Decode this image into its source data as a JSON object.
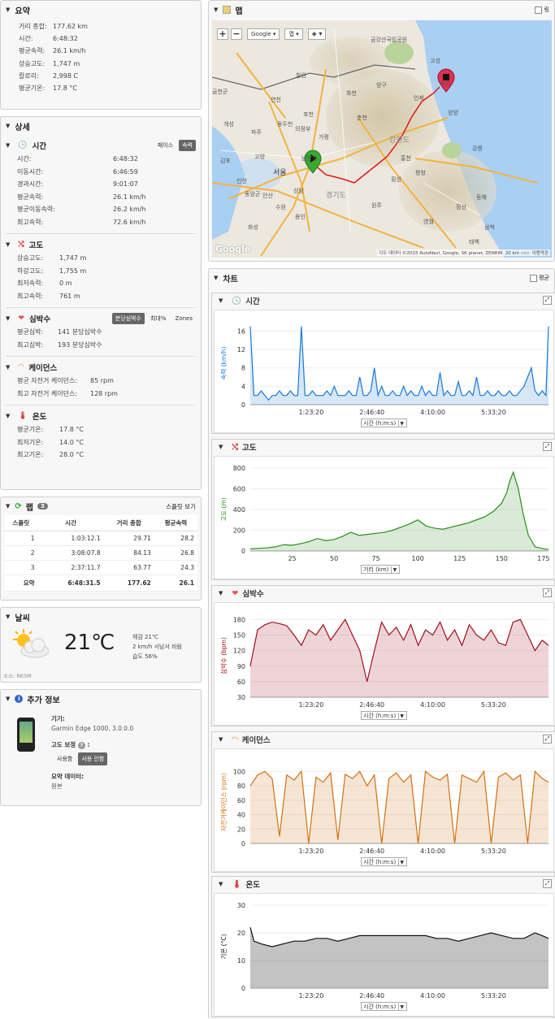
{
  "summary": {
    "title": "요약",
    "rows": [
      {
        "k": "거리 총합:",
        "v": "177.62 km"
      },
      {
        "k": "시간:",
        "v": "6:48:32"
      },
      {
        "k": "평균속력:",
        "v": "26.1 km/h"
      },
      {
        "k": "상승고도:",
        "v": "1,747 m"
      },
      {
        "k": "칼로리:",
        "v": "2,998 C"
      },
      {
        "k": "평균기온:",
        "v": "17.8 °C"
      }
    ]
  },
  "detail": {
    "title": "상세",
    "time": {
      "title": "시간",
      "pace": "페이스",
      "speed": "속력",
      "rows": [
        {
          "k": "시간:",
          "v": "6:48:32"
        },
        {
          "k": "이동시간:",
          "v": "6:46:59"
        },
        {
          "k": "경과시간:",
          "v": "9:01:07"
        },
        {
          "k": "평균속력:",
          "v": "26.1 km/h"
        },
        {
          "k": "평균이동속력:",
          "v": "26.2 km/h"
        },
        {
          "k": "최고속력:",
          "v": "72.6 km/h"
        }
      ]
    },
    "elev": {
      "title": "고도",
      "rows": [
        {
          "k": "상승고도:",
          "v": "1,747 m"
        },
        {
          "k": "하강고도:",
          "v": "1,755 m"
        },
        {
          "k": "최저속력:",
          "v": "0 m"
        },
        {
          "k": "최고속력:",
          "v": "761 m"
        }
      ]
    },
    "hr": {
      "title": "심박수",
      "opt1": "분당심박수",
      "opt2": "최대%",
      "opt3": "Zones",
      "rows": [
        {
          "k": "평균심박:",
          "v": "141 분당심박수"
        },
        {
          "k": "최고심박:",
          "v": "193 분당심박수"
        }
      ]
    },
    "cad": {
      "title": "케이던스",
      "rows": [
        {
          "k": "평균 자전거 케이던스:",
          "v": "85 rpm"
        },
        {
          "k": "최고 자전거 케이던스:",
          "v": "128 rpm"
        }
      ]
    },
    "temp": {
      "title": "온도",
      "rows": [
        {
          "k": "평균기온:",
          "v": "17.8 °C"
        },
        {
          "k": "최저기온:",
          "v": "14.0 °C"
        },
        {
          "k": "최고기온:",
          "v": "28.0 °C"
        }
      ]
    }
  },
  "laps": {
    "title": "랩",
    "count": "3",
    "split_view": "스플릿 보기",
    "headers": [
      "스플릿",
      "시간",
      "거리 총합",
      "평균속력"
    ],
    "rows": [
      [
        "1",
        "1:03:12.1",
        "29.71",
        "28.2"
      ],
      [
        "2",
        "3:08:07.8",
        "84.13",
        "26.8"
      ],
      [
        "3",
        "2:37:11.7",
        "63.77",
        "24.3"
      ]
    ],
    "total": [
      "요약",
      "6:48:31.5",
      "177.62",
      "26.1"
    ]
  },
  "weather": {
    "title": "날씨",
    "temp": "21℃",
    "feels": "체감 21℃",
    "wind": "2 km/h 서남서 비람",
    "humidity": "습도 56%",
    "source": "소스: RKSM"
  },
  "extra": {
    "title": "추가 정보",
    "device_label": "기기:",
    "device": "Garmin Edge 1000, 3.0.0.0",
    "elev_corr_label": "고도 보정",
    "corr_on": "사용함",
    "corr_off": "사용 안함",
    "summary_data_label": "요약 데이터:",
    "summary_data": "원본"
  },
  "map": {
    "title": "맵",
    "fullscreen_label": "링",
    "provider": "Google",
    "maptype": "맵",
    "google_logo": "Google",
    "attribution": "지도 데이터 ©2015 AutoNavi, Google, SK planet, ZENRIN",
    "scale": "20 km",
    "terms": "이용약관",
    "labels": [
      "금강산국립공원",
      "고성",
      "철원",
      "양구",
      "화천",
      "인제",
      "속초",
      "양양",
      "연천",
      "포천",
      "춘천",
      "가평",
      "개성",
      "파주",
      "동두천",
      "의정부",
      "강원도",
      "홍천",
      "강릉",
      "고양",
      "남양주",
      "횡성",
      "평창",
      "인천",
      "서울",
      "성남",
      "경기도",
      "안산",
      "수원",
      "용인",
      "원주",
      "정선",
      "영월",
      "동해",
      "삼척",
      "태백",
      "화성",
      "금천군",
      "동암군",
      "김포"
    ]
  },
  "charts": {
    "title": "차트",
    "avg_label": "평균",
    "time": {
      "title": "시간",
      "ylabel": "속력 (km/h)",
      "xsel": "시간 (h:m:s)",
      "yticks": [
        "0",
        "4",
        "8",
        "12",
        "16"
      ],
      "xticks": [
        "1:23:20",
        "2:46:40",
        "4:10:00",
        "5:33:20"
      ],
      "color": "#1a78d8"
    },
    "elev": {
      "title": "고도",
      "ylabel": "고도 (m)",
      "xsel": "거리 (km)",
      "yticks": [
        "0",
        "200",
        "400",
        "600",
        "800"
      ],
      "xticks": [
        "25",
        "50",
        "75",
        "100",
        "125",
        "150",
        "175"
      ],
      "color": "#2e8b1e"
    },
    "hr": {
      "title": "심박수",
      "ylabel": "심박수 (bpm)",
      "xsel": "시간 (h:m:s)",
      "yticks": [
        "30",
        "60",
        "90",
        "120",
        "150",
        "180"
      ],
      "xticks": [
        "1:23:20",
        "2:46:40",
        "4:10:00",
        "5:33:20"
      ],
      "color": "#a01020"
    },
    "cad": {
      "title": "케이던스",
      "ylabel": "자전거케이던스 (rpm)",
      "xsel": "시간 (h:m:s)",
      "yticks": [
        "0",
        "20",
        "40",
        "60",
        "80",
        "100"
      ],
      "xticks": [
        "1:23:20",
        "2:46:40",
        "4:10:00",
        "5:33:20"
      ],
      "color": "#d27010"
    },
    "temp": {
      "title": "온도",
      "ylabel": "기온 (°C)",
      "xsel": "시간 (h:m:s)",
      "yticks": [
        "0",
        "10",
        "20",
        "30"
      ],
      "xticks": [
        "1:23:20",
        "2:46:40",
        "4:10:00",
        "5:33:20"
      ],
      "color": "#111111"
    }
  },
  "chart_data": [
    {
      "type": "area",
      "title": "",
      "xlabel": "시간 (h:m:s)",
      "ylabel": "속력 (km/h)",
      "xlim": [
        0,
        24512
      ],
      "ylim": [
        0,
        18
      ],
      "series": [
        {
          "x": [
            0,
            300,
            600,
            900,
            1200,
            1500,
            1800,
            2100,
            2400,
            2700,
            3000,
            3300,
            3600,
            3900,
            4200,
            4500,
            4800,
            5100,
            5400,
            5700,
            6000,
            6300,
            6600,
            6900,
            7200,
            7500,
            7800,
            8100,
            8400,
            8700,
            9000,
            9300,
            9600,
            9900,
            10200,
            10500,
            10800,
            11100,
            11400,
            11700,
            12000,
            12300,
            12600,
            12900,
            13200,
            13500,
            13800,
            14100,
            14400,
            14700,
            15000,
            15300,
            15600,
            15900,
            16200,
            16500,
            16800,
            17100,
            17400,
            17700,
            18000,
            18300,
            18600,
            18900,
            19200,
            19500,
            19800,
            20100,
            20400,
            20700,
            21000,
            21300,
            21600,
            21900,
            22200,
            22500,
            22800,
            23100,
            23400,
            23700,
            24000,
            24300,
            24512
          ],
          "values": [
            17,
            2,
            2,
            3,
            2,
            1,
            2,
            2,
            3,
            2,
            2,
            3,
            2,
            2,
            17,
            2,
            2,
            3,
            2,
            2,
            2,
            3,
            2,
            4,
            2,
            2,
            2,
            3,
            2,
            2,
            6,
            2,
            2,
            3,
            8,
            2,
            4,
            2,
            2,
            3,
            2,
            2,
            4,
            2,
            3,
            2,
            2,
            4,
            2,
            3,
            2,
            2,
            7,
            2,
            3,
            2,
            2,
            5,
            2,
            2,
            3,
            2,
            6,
            2,
            2,
            3,
            2,
            2,
            3,
            2,
            2,
            3,
            2,
            2,
            3,
            4,
            6,
            8,
            3,
            2,
            3,
            2,
            17
          ]
        }
      ]
    },
    {
      "type": "area",
      "title": "",
      "xlabel": "거리 (km)",
      "ylabel": "고도 (m)",
      "xlim": [
        0,
        178
      ],
      "ylim": [
        0,
        800
      ],
      "series": [
        {
          "x": [
            0,
            5,
            10,
            15,
            20,
            25,
            30,
            35,
            40,
            45,
            50,
            55,
            60,
            65,
            70,
            75,
            80,
            85,
            90,
            95,
            100,
            105,
            110,
            115,
            120,
            125,
            130,
            135,
            140,
            145,
            150,
            153,
            155,
            157,
            160,
            163,
            166,
            170,
            175,
            178
          ],
          "values": [
            20,
            25,
            30,
            40,
            60,
            55,
            70,
            90,
            120,
            100,
            110,
            140,
            180,
            150,
            160,
            170,
            180,
            200,
            230,
            260,
            300,
            240,
            220,
            210,
            230,
            250,
            270,
            300,
            330,
            380,
            460,
            560,
            680,
            760,
            600,
            350,
            150,
            40,
            20,
            15
          ]
        }
      ]
    },
    {
      "type": "area",
      "title": "",
      "xlabel": "시간 (h:m:s)",
      "ylabel": "심박수 (bpm)",
      "xlim": [
        0,
        24512
      ],
      "ylim": [
        30,
        190
      ],
      "series": [
        {
          "x": [
            0,
            600,
            1200,
            1800,
            2400,
            3000,
            3600,
            4200,
            4800,
            5400,
            6000,
            6600,
            7200,
            7800,
            8400,
            9000,
            9600,
            10200,
            10800,
            11400,
            12000,
            12600,
            13200,
            13800,
            14400,
            15000,
            15600,
            16200,
            16800,
            17400,
            18000,
            18600,
            19200,
            19800,
            20400,
            21000,
            21600,
            22200,
            22800,
            23400,
            24000,
            24512
          ],
          "values": [
            90,
            160,
            170,
            175,
            172,
            168,
            150,
            130,
            160,
            150,
            170,
            140,
            160,
            180,
            150,
            120,
            60,
            120,
            175,
            150,
            165,
            140,
            170,
            130,
            160,
            150,
            175,
            140,
            160,
            130,
            170,
            150,
            140,
            160,
            135,
            130,
            175,
            180,
            150,
            120,
            140,
            130
          ]
        }
      ]
    },
    {
      "type": "area",
      "title": "",
      "xlabel": "시간 (h:m:s)",
      "ylabel": "자전거케이던스 (rpm)",
      "xlim": [
        0,
        24512
      ],
      "ylim": [
        0,
        115
      ],
      "series": [
        {
          "x": [
            0,
            600,
            1200,
            1800,
            2400,
            3000,
            3600,
            4200,
            4800,
            5400,
            6000,
            6600,
            7200,
            7800,
            8400,
            9000,
            9600,
            10200,
            10800,
            11400,
            12000,
            12600,
            13200,
            13800,
            14400,
            15000,
            15600,
            16200,
            16800,
            17400,
            18000,
            18600,
            19200,
            19800,
            20400,
            21000,
            21600,
            22200,
            22800,
            23400,
            24000,
            24512
          ],
          "values": [
            80,
            95,
            100,
            90,
            10,
            95,
            88,
            100,
            0,
            92,
            85,
            98,
            5,
            96,
            90,
            100,
            80,
            95,
            0,
            90,
            98,
            85,
            95,
            0,
            100,
            92,
            88,
            96,
            0,
            95,
            90,
            85,
            100,
            0,
            92,
            98,
            88,
            95,
            0,
            100,
            90,
            85
          ]
        }
      ]
    },
    {
      "type": "area",
      "title": "",
      "xlabel": "시간 (h:m:s)",
      "ylabel": "기온 (°C)",
      "xlim": [
        0,
        24512
      ],
      "ylim": [
        0,
        30
      ],
      "series": [
        {
          "x": [
            0,
            300,
            900,
            1800,
            2700,
            3600,
            4500,
            5400,
            6300,
            7200,
            8100,
            9000,
            9900,
            10800,
            11700,
            12600,
            13500,
            14400,
            15300,
            16200,
            17100,
            18000,
            18900,
            19800,
            20700,
            21600,
            22500,
            23400,
            24000,
            24512
          ],
          "values": [
            22,
            17,
            16,
            15,
            16,
            17,
            17,
            18,
            18,
            17,
            18,
            19,
            19,
            19,
            19,
            19,
            19,
            19,
            18,
            18,
            17,
            18,
            19,
            20,
            19,
            18,
            18,
            20,
            19,
            18
          ]
        }
      ]
    }
  ]
}
